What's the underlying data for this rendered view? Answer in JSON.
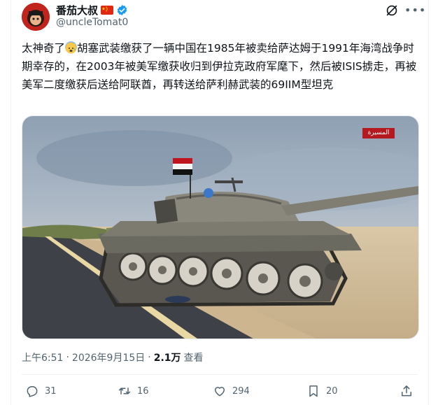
{
  "author": {
    "display_name": "番茄大叔",
    "handle": "@uncleTomat0",
    "flag_icon": "china-flag-icon",
    "verified_icon": "verified-badge-icon",
    "verified_color": "#1d9bf0"
  },
  "tweet": {
    "text_part1": "太神奇了",
    "text_part2": "胡塞武装缴获了一辆中国在1985年被卖给萨达姆于1991年海湾战争时期幸存的，在2003年被美军缴获收归到伊拉克政府军麾下，然后被ISIS掳走，再被美军二度缴获后送给阿联酋，再转送给萨利赫武装的69IIM型坦克",
    "emoji_icon": "anxious-face-emoji-icon"
  },
  "media": {
    "watermark": "المسيرة",
    "description_icon": "tank-photo"
  },
  "meta": {
    "time": "上午6:51",
    "separator": "·",
    "date": "2026年9月15日",
    "views_count": "2.1万",
    "views_label": "查看"
  },
  "actions": {
    "replies": "31",
    "retweets": "16",
    "likes": "294",
    "bookmarks": "20"
  },
  "colors": {
    "text_primary": "#0f1419",
    "text_secondary": "#536471",
    "divider": "#eff3f4"
  }
}
